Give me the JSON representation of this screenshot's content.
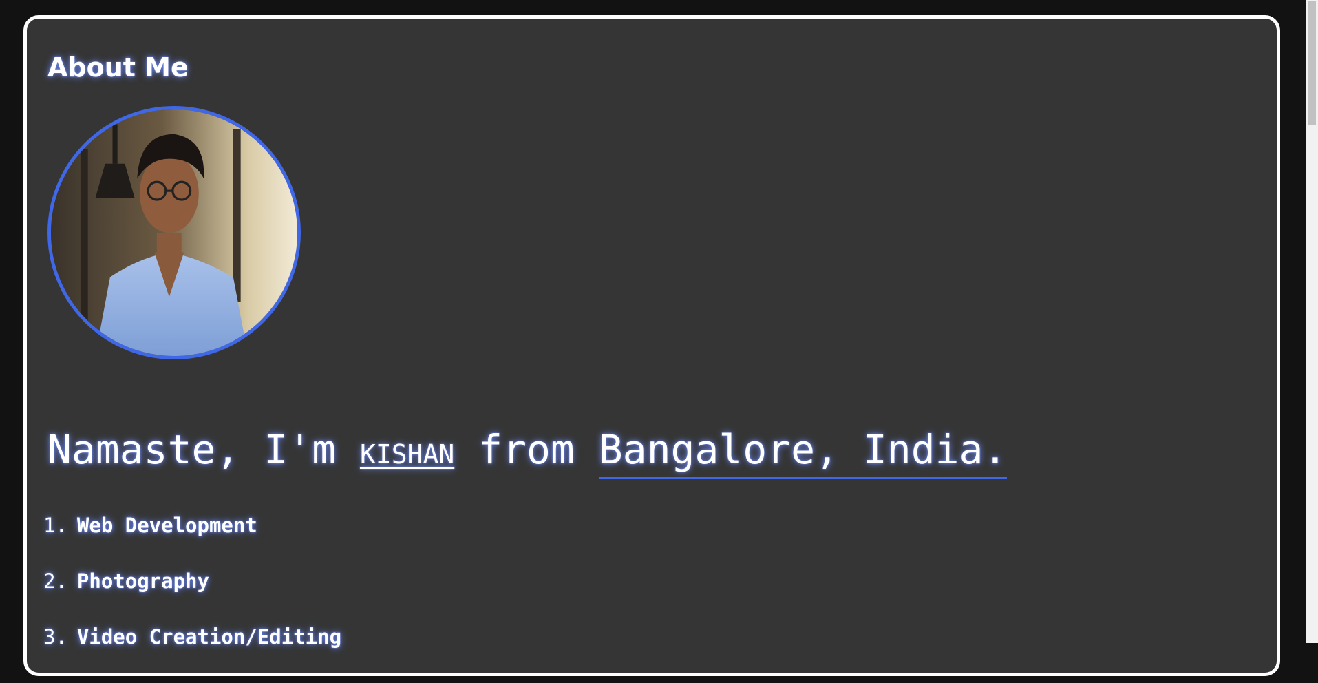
{
  "section": {
    "title": "About Me"
  },
  "avatar": {
    "alt": "Profile photo",
    "icon": "profile-photo",
    "border_color": "#3f67e6"
  },
  "intro": {
    "greeting": "Namaste, I'm ",
    "name": "KISHAN",
    "connector": " from ",
    "location": "Bangalore, India."
  },
  "skills": [
    {
      "number": "1.",
      "label": "Web Development"
    },
    {
      "number": "2.",
      "label": "Photography"
    },
    {
      "number": "3.",
      "label": "Video Creation/Editing"
    }
  ],
  "colors": {
    "page_background": "#121212",
    "card_background": "#353535",
    "card_border": "#ffffff",
    "accent": "#3f67e6",
    "glow": "#6e8cff",
    "text": "#ffffff"
  }
}
